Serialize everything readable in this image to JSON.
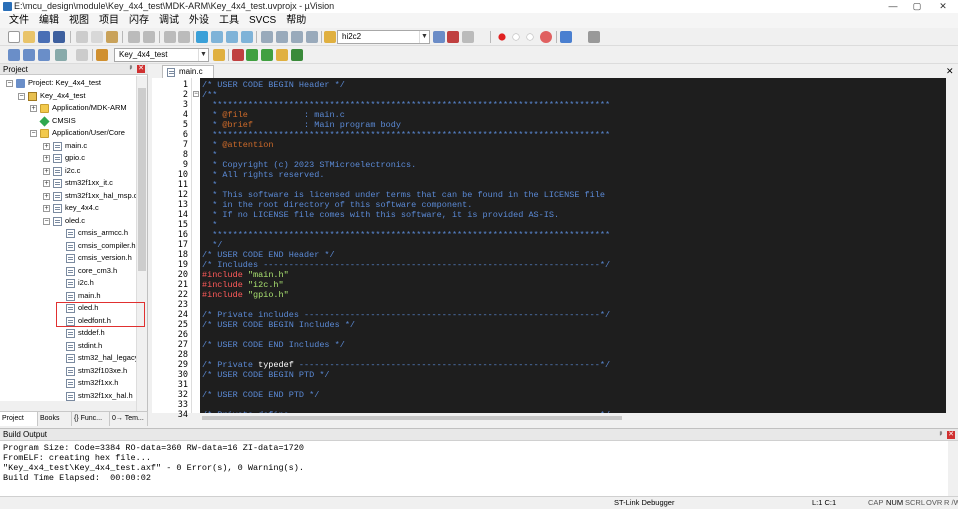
{
  "window": {
    "title": "E:\\mcu_design\\module\\Key_4x4_test\\MDK-ARM\\Key_4x4_test.uvprojx - µVision",
    "minimize": "—",
    "maximize": "▢",
    "close": "✕"
  },
  "menu": [
    "文件",
    "编辑",
    "视图",
    "项目",
    "闪存",
    "调试",
    "外设",
    "工具",
    "SVCS",
    "帮助"
  ],
  "toolbar": {
    "find_combo_value": "hi2c2",
    "target_combo_value": "Key_4x4_test"
  },
  "project_panel": {
    "title": "Project",
    "tree": [
      {
        "label": "Project: Key_4x4_test",
        "level": 0,
        "expander": "−",
        "icon": "project-icon"
      },
      {
        "label": "Key_4x4_test",
        "level": 1,
        "expander": "−",
        "icon": "target-icon"
      },
      {
        "label": "Application/MDK-ARM",
        "level": 2,
        "expander": "+",
        "icon": "folder-icon"
      },
      {
        "label": "CMSIS",
        "level": 2,
        "expander": "",
        "icon": "cmsis-gem-icon"
      },
      {
        "label": "Application/User/Core",
        "level": 2,
        "expander": "−",
        "icon": "folder-icon"
      },
      {
        "label": "main.c",
        "level": 3,
        "expander": "+",
        "icon": "file-icon"
      },
      {
        "label": "gpio.c",
        "level": 3,
        "expander": "+",
        "icon": "file-icon"
      },
      {
        "label": "i2c.c",
        "level": 3,
        "expander": "+",
        "icon": "file-icon"
      },
      {
        "label": "stm32f1xx_it.c",
        "level": 3,
        "expander": "+",
        "icon": "file-icon"
      },
      {
        "label": "stm32f1xx_hal_msp.c",
        "level": 3,
        "expander": "+",
        "icon": "file-icon"
      },
      {
        "label": "key_4x4.c",
        "level": 3,
        "expander": "+",
        "icon": "file-icon"
      },
      {
        "label": "oled.c",
        "level": 3,
        "expander": "−",
        "icon": "file-icon"
      },
      {
        "label": "cmsis_armcc.h",
        "level": 4,
        "expander": "",
        "icon": "file-icon"
      },
      {
        "label": "cmsis_compiler.h",
        "level": 4,
        "expander": "",
        "icon": "file-icon"
      },
      {
        "label": "cmsis_version.h",
        "level": 4,
        "expander": "",
        "icon": "file-icon"
      },
      {
        "label": "core_cm3.h",
        "level": 4,
        "expander": "",
        "icon": "file-icon"
      },
      {
        "label": "i2c.h",
        "level": 4,
        "expander": "",
        "icon": "file-icon"
      },
      {
        "label": "main.h",
        "level": 4,
        "expander": "",
        "icon": "file-icon"
      },
      {
        "label": "oled.h",
        "level": 4,
        "expander": "",
        "icon": "file-icon"
      },
      {
        "label": "oledfont.h",
        "level": 4,
        "expander": "",
        "icon": "file-icon"
      },
      {
        "label": "stddef.h",
        "level": 4,
        "expander": "",
        "icon": "file-icon"
      },
      {
        "label": "stdint.h",
        "level": 4,
        "expander": "",
        "icon": "file-icon"
      },
      {
        "label": "stm32_hal_legacy",
        "level": 4,
        "expander": "",
        "icon": "file-icon"
      },
      {
        "label": "stm32f103xe.h",
        "level": 4,
        "expander": "",
        "icon": "file-icon"
      },
      {
        "label": "stm32f1xx.h",
        "level": 4,
        "expander": "",
        "icon": "file-icon"
      },
      {
        "label": "stm32f1xx_hal.h",
        "level": 4,
        "expander": "",
        "icon": "file-icon"
      }
    ],
    "tabs": [
      "Project",
      "Books",
      "{} Func...",
      "0→ Tem..."
    ]
  },
  "editor": {
    "tab_label": "main.c",
    "lines": [
      [
        [
          "c-cm",
          "/* USER CODE BEGIN Header */"
        ]
      ],
      [
        [
          "c-cm",
          "/**"
        ]
      ],
      [
        [
          "c-cm",
          "  ******************************************************************************"
        ]
      ],
      [
        [
          "c-cm",
          "  * "
        ],
        [
          "c-dk",
          "@file"
        ],
        [
          "c-cm",
          "           : main.c"
        ]
      ],
      [
        [
          "c-cm",
          "  * "
        ],
        [
          "c-dk",
          "@brief"
        ],
        [
          "c-cm",
          "          : Main program body"
        ]
      ],
      [
        [
          "c-cm",
          "  ******************************************************************************"
        ]
      ],
      [
        [
          "c-cm",
          "  * "
        ],
        [
          "c-dk",
          "@attention"
        ]
      ],
      [
        [
          "c-cm",
          "  *"
        ]
      ],
      [
        [
          "c-cm",
          "  * Copyright (c) 2023 STMicroelectronics."
        ]
      ],
      [
        [
          "c-cm",
          "  * All rights reserved."
        ]
      ],
      [
        [
          "c-cm",
          "  *"
        ]
      ],
      [
        [
          "c-cm",
          "  * This software is licensed under terms that can be found in the LICENSE file"
        ]
      ],
      [
        [
          "c-cm",
          "  * in the root directory of this software component."
        ]
      ],
      [
        [
          "c-cm",
          "  * If no LICENSE file comes with this software, it is provided AS-IS."
        ]
      ],
      [
        [
          "c-cm",
          "  *"
        ]
      ],
      [
        [
          "c-cm",
          "  ******************************************************************************"
        ]
      ],
      [
        [
          "c-cm",
          "  */"
        ]
      ],
      [
        [
          "c-cm",
          "/* USER CODE END Header */"
        ]
      ],
      [
        [
          "c-cm",
          "/* Includes ------------------------------------------------------------------*/"
        ]
      ],
      [
        [
          "c-pp",
          "#include "
        ],
        [
          "c-str",
          "\"main.h\""
        ]
      ],
      [
        [
          "c-pp",
          "#include "
        ],
        [
          "c-str",
          "\"i2c.h\""
        ]
      ],
      [
        [
          "c-pp",
          "#include "
        ],
        [
          "c-str",
          "\"gpio.h\""
        ]
      ],
      [],
      [
        [
          "c-cm",
          "/* Private includes ----------------------------------------------------------*/"
        ]
      ],
      [
        [
          "c-cm",
          "/* USER CODE BEGIN Includes */"
        ]
      ],
      [],
      [
        [
          "c-cm",
          "/* USER CODE END Includes */"
        ]
      ],
      [],
      [
        [
          "c-cm",
          "/* Private "
        ],
        [
          "c-kw",
          "typedef"
        ],
        [
          "c-cm",
          " -----------------------------------------------------------*/"
        ]
      ],
      [
        [
          "c-cm",
          "/* USER CODE BEGIN PTD */"
        ]
      ],
      [],
      [
        [
          "c-cm",
          "/* USER CODE END PTD */"
        ]
      ],
      [],
      [
        [
          "c-cm",
          "/* Private define ------------------------------------------------------------*/"
        ]
      ]
    ]
  },
  "build_output": {
    "title": "Build Output",
    "lines": [
      "Program Size: Code=3384 RO-data=360 RW-data=16 ZI-data=1720",
      "FromELF: creating hex file...",
      "\"Key_4x4_test\\Key_4x4_test.axf\" - 0 Error(s), 0 Warning(s).",
      "Build Time Elapsed:  00:00:02"
    ]
  },
  "status_bar": {
    "debugger": "ST-Link Debugger",
    "cursor": "L:1 C:1",
    "caps": "CAP",
    "num": "NUM",
    "scrl": "SCRL",
    "ovr": "OVR",
    "rw": "R /W"
  },
  "colors": {
    "editor_bg": "#1e1e1e",
    "comment": "#5b8ad6",
    "doc_keyword": "#cc6a2a",
    "preprocessor": "#ff5a5a",
    "string": "#a8e070",
    "highlight_box": "#e03030"
  }
}
